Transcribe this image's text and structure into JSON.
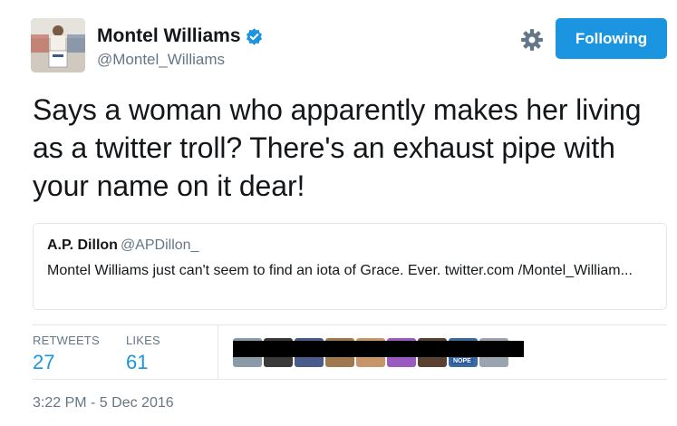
{
  "author": {
    "display_name": "Montel Williams",
    "handle": "@Montel_Williams",
    "verified": true
  },
  "actions": {
    "follow_label": "Following",
    "settings_icon": "gear-icon"
  },
  "tweet": {
    "text": "Says a woman who apparently makes her living as a twitter troll? There's an exhaust pipe with your name on it dear!"
  },
  "quoted_tweet": {
    "name": "A.P. Dillon",
    "handle": "@APDillon_",
    "text": "Montel Williams just can't seem to find an iota of Grace. Ever. twitter.com /Montel_William..."
  },
  "stats": {
    "retweets_label": "RETWEETS",
    "retweets_value": "27",
    "likes_label": "LIKES",
    "likes_value": "61"
  },
  "likers": {
    "colors": [
      "#8a9aa8",
      "#3a3a3a",
      "#4a5a8a",
      "#a07850",
      "#c8946a",
      "#9a5ac0",
      "#5a4030",
      "#3a6aa0",
      "#9aa4b0"
    ],
    "badge_texts": [
      "",
      "",
      "",
      "",
      "",
      "",
      "",
      "NOPE",
      ""
    ]
  },
  "timestamp": "3:22 PM - 5 Dec 2016",
  "colors": {
    "accent": "#1b95e0",
    "secondary_text": "#657786",
    "border": "#e1e8ed"
  }
}
